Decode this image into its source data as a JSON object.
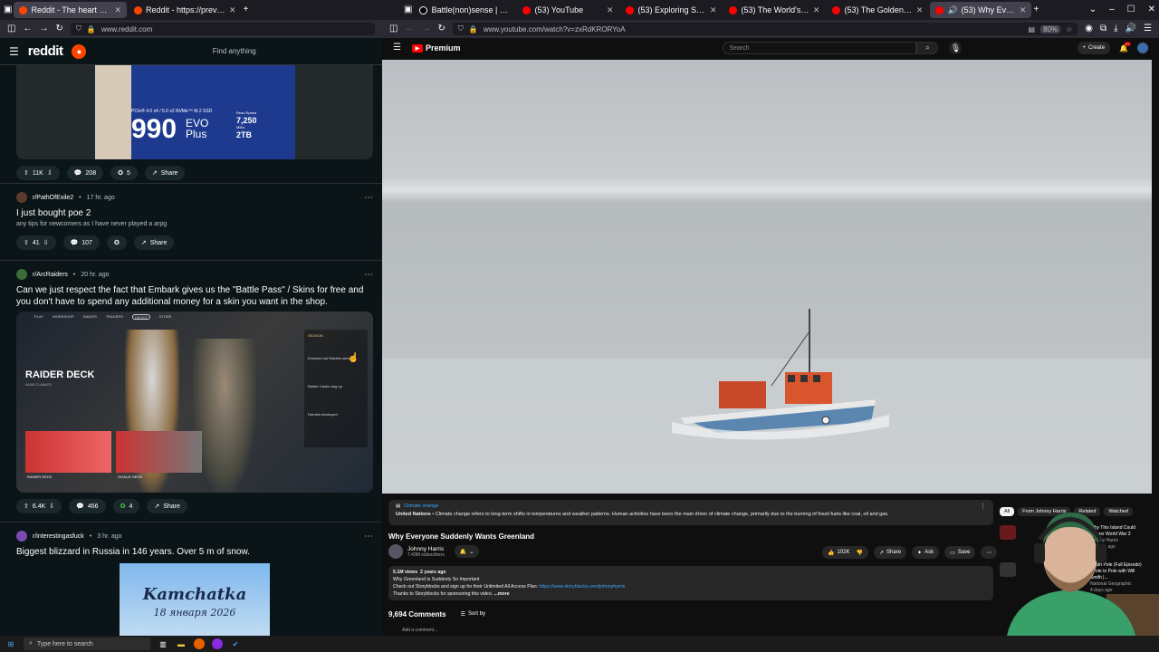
{
  "left_browser": {
    "tabs": [
      {
        "label": "Reddit - The heart of the internet",
        "active": true
      },
      {
        "label": "Reddit - https://preview.redd.it",
        "active": false
      }
    ],
    "url": "www.reddit.com"
  },
  "reddit": {
    "logo": "reddit",
    "search_placeholder": "Find anything",
    "posts": [
      {
        "votes": "11K",
        "comments": "208",
        "awards": "5",
        "share": "Share",
        "ssd_line": "PCIe® 4.0 x4 / 5.0 x2 NVMe™ M.2 SSD",
        "ssd_model": "990",
        "ssd_brand": "EVO",
        "ssd_variant": "Plus",
        "ssd_capacity": "2TB",
        "ssd_speed_label": "Read Speed",
        "ssd_speed": "7,250",
        "ssd_speed_unit": "MB/s"
      },
      {
        "subreddit": "r/PathOfExile2",
        "time": "17 hr. ago",
        "title": "I just bought poe 2",
        "body": "any tips for newcomers as I have never played a arpg",
        "votes": "41",
        "comments": "107",
        "share": "Share"
      },
      {
        "subreddit": "r/ArcRaiders",
        "time": "20 hr. ago",
        "title": "Can we just respect the fact that Embark gives us the \"Battle Pass\" / Skins for free and you don't have to spend any additional money for a skin you want in the shop.",
        "image_heading": "RAIDER DECK",
        "image_subheading": "84/88 CLAIMED",
        "image_labels": [
          "RAIDER DECK",
          "GOALIE DECK"
        ],
        "image_panel_items": [
          "Knocked out Raiders sleep",
          "Raider Cache dug up",
          "Hornets destroyed"
        ],
        "image_panel_tag": "SEASON",
        "image_nav": [
          "PLAY",
          "WORKSHOP",
          "RAIDER",
          "TRADERS",
          "DECKS",
          "STORE"
        ],
        "votes": "6.4K",
        "comments": "466",
        "awards": "4",
        "share": "Share"
      },
      {
        "subreddit": "r/interestingasfuck",
        "time": "3 hr. ago",
        "title": "Biggest blizzard in Russia in 146 years. Over 5 m of snow.",
        "image_text": "Kamchatka",
        "image_date": "18 января 2026"
      }
    ]
  },
  "right_browser": {
    "tabs": [
      {
        "label": "Battle(non)sense | Chris on X",
        "active": false
      },
      {
        "label": "(53) YouTube",
        "active": false
      },
      {
        "label": "(53) Exploring Scotland's Forgotten",
        "active": false
      },
      {
        "label": "(53) The World's Smallest Apartment",
        "active": false
      },
      {
        "label": "(53) The Golden Globes Hoppers",
        "active": false
      },
      {
        "label": "(53) Why Everyone Suddenly",
        "active": true
      }
    ],
    "url": "www.youtube.com/watch?v=zxRdKRORYoA",
    "zoom": "80%"
  },
  "youtube": {
    "logo_text": "Premium",
    "search_placeholder": "Search",
    "create_label": "Create",
    "notif_count": "9+",
    "notice_link": "Climate change",
    "notice_source": "United Nations",
    "notice_text": "Climate change refers to long-term shifts in temperatures and weather patterns. Human activities have been the main driver of climate change, primarily due to the burning of fossil fuels like coal, oil and gas.",
    "title": "Why Everyone Suddenly Wants Greenland",
    "channel": "Johnny Harris",
    "subscribers": "7.43M subscribers",
    "likes": "102K",
    "share": "Share",
    "ask": "Ask",
    "save": "Save",
    "views": "5.1M views",
    "age": "2 years ago",
    "desc_line1": "Why Greenland is Suddenly So Important",
    "desc_line2": "Check out Storyblocks and sign up for their Unlimited All Access Plan:",
    "desc_link": "https://www.storyblocks.com/johnnyharris",
    "desc_line3": "Thanks to Storyblocks for sponsoring this video.",
    "desc_more": "...more",
    "comments_count": "9,694 Comments",
    "sort_by": "Sort by",
    "add_comment": "Add a comment...",
    "chips": [
      "All",
      "From Johnny Harris",
      "Related",
      "Watched"
    ],
    "side": [
      {
        "title": "Why This Island Could Trigger World War 3",
        "channel": "Johnny Harris",
        "meta": "1 month ago"
      },
      {
        "title": "South Pole (Full Episode) | Pole to Pole with Will Smith |...",
        "channel": "National Geographic",
        "meta": "4 days ago"
      }
    ]
  },
  "taskbar": {
    "search_placeholder": "Type here to search"
  }
}
